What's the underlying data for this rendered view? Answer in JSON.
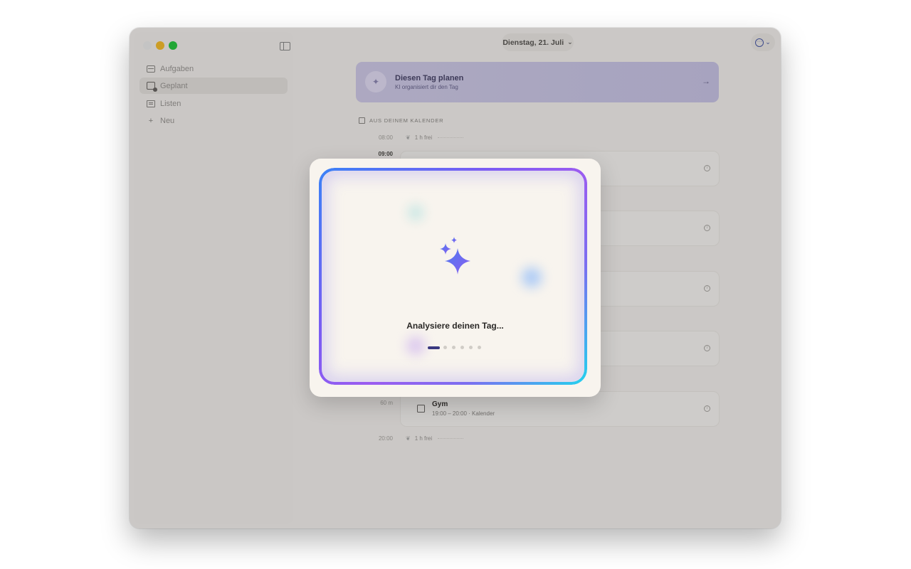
{
  "window": {
    "date_label": "Dienstag, 21. Juli"
  },
  "sidebar": {
    "items": [
      {
        "label": "Aufgaben",
        "icon": "inbox-icon"
      },
      {
        "label": "Geplant",
        "icon": "calendar-icon",
        "active": true
      },
      {
        "label": "Listen",
        "icon": "list-icon"
      },
      {
        "label": "Neu",
        "icon": "plus-icon"
      }
    ]
  },
  "plan_banner": {
    "title": "Diesen Tag planen",
    "subtitle": "KI organisiert dir den Tag"
  },
  "calendar_section": {
    "header": "AUS DEINEM KALENDER",
    "rows": [
      {
        "time": "08:00",
        "free": "1 h frei"
      },
      {
        "time": "09:00"
      },
      {
        "duration": "60 m",
        "title": "Gym",
        "subtitle": "19:00 – 20:00 · Kalender"
      },
      {
        "time": "20:00",
        "free": "1 h frei"
      }
    ]
  },
  "modal": {
    "status": "Analysiere deinen Tag...",
    "progress": {
      "current_step": 1,
      "total_steps": 6
    }
  },
  "colors": {
    "accent": "#7c5cf3",
    "plan_banner": "#c9c5e6",
    "close": "#ececec",
    "minimize": "#f6bd2d",
    "maximize": "#29c840"
  }
}
